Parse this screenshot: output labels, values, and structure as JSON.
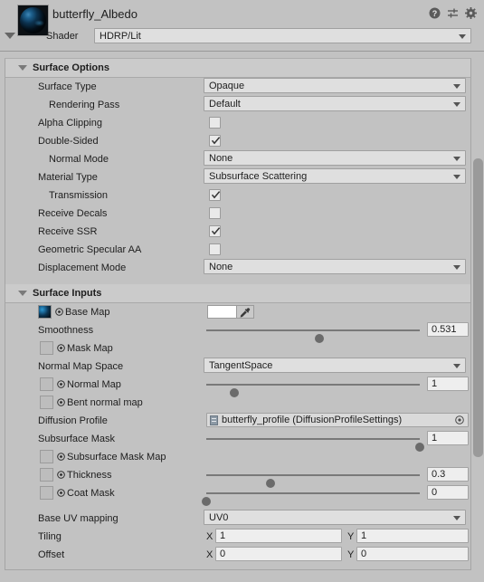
{
  "window": {
    "title": "butterfly_Albedo",
    "shader_label": "Shader",
    "shader_value": "HDRP/Lit",
    "icons": {
      "help": "help-icon",
      "preset": "preset-icon",
      "settings": "gear-icon"
    }
  },
  "sections": {
    "surface_options": {
      "title": "Surface Options",
      "rows": {
        "surface_type": {
          "label": "Surface Type",
          "value": "Opaque"
        },
        "rendering_pass": {
          "label": "Rendering Pass",
          "value": "Default"
        },
        "alpha_clipping": {
          "label": "Alpha Clipping",
          "checked": false
        },
        "double_sided": {
          "label": "Double-Sided",
          "checked": true
        },
        "normal_mode": {
          "label": "Normal Mode",
          "value": "None"
        },
        "material_type": {
          "label": "Material Type",
          "value": "Subsurface Scattering"
        },
        "transmission": {
          "label": "Transmission",
          "checked": true
        },
        "receive_decals": {
          "label": "Receive Decals",
          "checked": false
        },
        "receive_ssr": {
          "label": "Receive SSR",
          "checked": true
        },
        "geometric_specular_aa": {
          "label": "Geometric Specular AA",
          "checked": false
        },
        "displacement_mode": {
          "label": "Displacement Mode",
          "value": "None"
        }
      }
    },
    "surface_inputs": {
      "title": "Surface Inputs",
      "rows": {
        "base_map": {
          "label": "Base Map",
          "color": "#ffffff",
          "texture_filled": true
        },
        "smoothness": {
          "label": "Smoothness",
          "value": "0.531",
          "slider_pct": 53
        },
        "mask_map": {
          "label": "Mask Map",
          "texture_filled": false
        },
        "normal_map_space": {
          "label": "Normal Map Space",
          "value": "TangentSpace"
        },
        "normal_map": {
          "label": "Normal Map",
          "value": "1",
          "slider_pct": 13,
          "texture_filled": false
        },
        "bent_normal_map": {
          "label": "Bent normal map",
          "texture_filled": false
        },
        "diffusion_profile": {
          "label": "Diffusion Profile",
          "value": "butterfly_profile (DiffusionProfileSettings)"
        },
        "subsurface_mask": {
          "label": "Subsurface Mask",
          "value": "1",
          "slider_pct": 100
        },
        "subsurface_mask_map": {
          "label": "Subsurface Mask Map",
          "texture_filled": false
        },
        "thickness": {
          "label": "Thickness",
          "value": "0.3",
          "slider_pct": 30,
          "texture_filled": false
        },
        "coat_mask": {
          "label": "Coat Mask",
          "value": "0",
          "slider_pct": 0,
          "texture_filled": false
        },
        "base_uv_mapping": {
          "label": "Base UV mapping",
          "value": "UV0"
        },
        "tiling": {
          "label": "Tiling",
          "x_label": "X",
          "x": "1",
          "y_label": "Y",
          "y": "1"
        },
        "offset": {
          "label": "Offset",
          "x_label": "X",
          "x": "0",
          "y_label": "Y",
          "y": "0"
        }
      }
    }
  },
  "colors": {
    "window_bg": "#c2c2c2",
    "section_header_bg": "#cbcbcb",
    "field_bg": "#dfdfdf",
    "number_bg": "#eeeeee",
    "text": "#1d1d1d"
  }
}
